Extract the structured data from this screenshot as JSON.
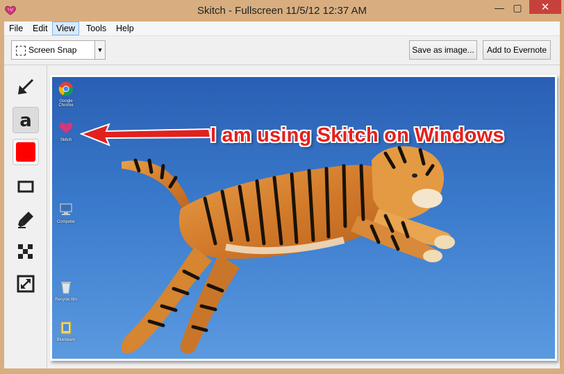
{
  "window": {
    "title": "Skitch - Fullscreen 11/5/12 12:37 AM",
    "minimize_glyph": "—",
    "maximize_glyph": "▢",
    "close_glyph": "✕",
    "icon": "skitch-heart-icon"
  },
  "menubar": {
    "items": [
      {
        "label": "File",
        "active": false
      },
      {
        "label": "Edit",
        "active": false
      },
      {
        "label": "View",
        "active": true
      },
      {
        "label": "Tools",
        "active": false
      },
      {
        "label": "Help",
        "active": false
      }
    ]
  },
  "toolbar": {
    "snap_mode": "Screen Snap",
    "save_label": "Save as image...",
    "evernote_label": "Add to Evernote"
  },
  "tools": [
    {
      "name": "arrow-tool",
      "icon": "arrow-icon",
      "selected": false
    },
    {
      "name": "text-tool",
      "icon": "text-a-icon",
      "selected": true
    },
    {
      "name": "color-tool",
      "icon": "red-swatch-icon",
      "selected": false,
      "color": "#ff0000"
    },
    {
      "name": "rectangle-tool",
      "icon": "rectangle-icon",
      "selected": false
    },
    {
      "name": "highlighter-tool",
      "icon": "marker-icon",
      "selected": false
    },
    {
      "name": "pixelate-tool",
      "icon": "pixelate-icon",
      "selected": false
    },
    {
      "name": "crop-resize-tool",
      "icon": "resize-icon",
      "selected": false
    }
  ],
  "canvas": {
    "annotation_text": "I am using Skitch on Windows",
    "annotation_color": "#e2211d",
    "desktop_icons": [
      {
        "label": "Google Chrome",
        "icon": "chrome-icon"
      },
      {
        "label": "Skitch",
        "icon": "skitch-icon"
      },
      {
        "label": "Computer",
        "icon": "computer-icon"
      },
      {
        "label": "Recycle Bin",
        "icon": "recycle-bin-icon"
      },
      {
        "label": "Bluebeam",
        "icon": "folder-icon"
      }
    ]
  }
}
